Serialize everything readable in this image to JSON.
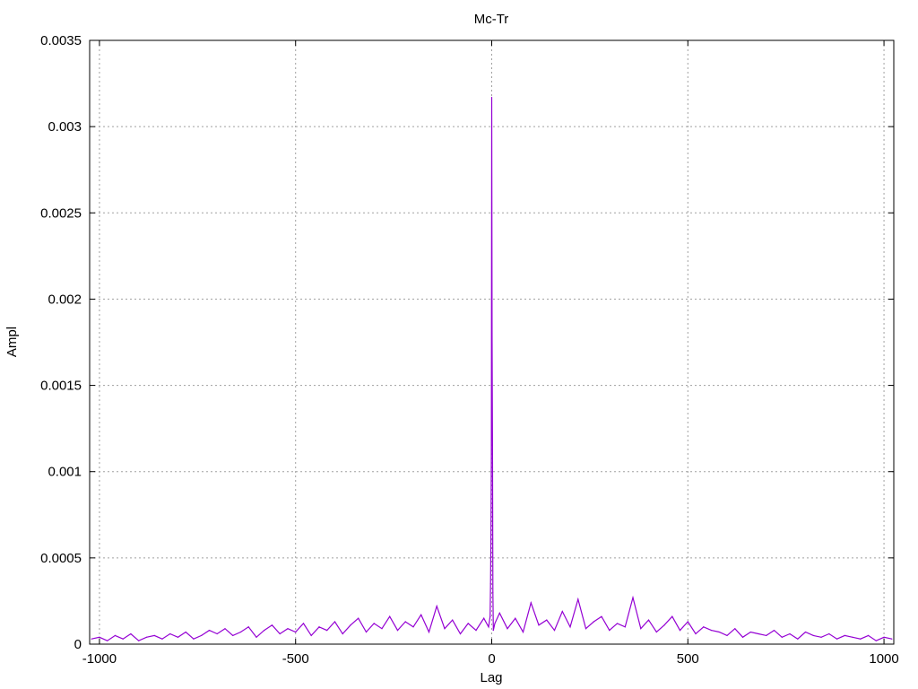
{
  "chart_data": {
    "type": "line",
    "title": "Mc-Tr",
    "xlabel": "Lag",
    "ylabel": "Ampl",
    "xlim": [
      -1025,
      1025
    ],
    "ylim": [
      0,
      0.0035
    ],
    "grid": true,
    "x_ticks": [
      -1000,
      -500,
      0,
      500,
      1000
    ],
    "x_tick_labels": [
      "-1000",
      "-500",
      "0",
      "500",
      "1000"
    ],
    "y_ticks": [
      0,
      0.0005,
      0.001,
      0.0015,
      0.002,
      0.0025,
      0.003,
      0.0035
    ],
    "y_tick_labels": [
      "0",
      "0.0005",
      "0.001",
      "0.0015",
      "0.002",
      "0.0025",
      "0.003",
      "0.0035"
    ],
    "series": [
      {
        "name": "Mc-Tr",
        "color": "#9400d3",
        "x": [
          -1020,
          -1000,
          -980,
          -960,
          -940,
          -920,
          -900,
          -880,
          -860,
          -840,
          -820,
          -800,
          -780,
          -760,
          -740,
          -720,
          -700,
          -680,
          -660,
          -640,
          -620,
          -600,
          -580,
          -560,
          -540,
          -520,
          -500,
          -480,
          -460,
          -440,
          -420,
          -400,
          -380,
          -360,
          -340,
          -320,
          -300,
          -280,
          -260,
          -240,
          -220,
          -200,
          -180,
          -160,
          -140,
          -120,
          -100,
          -80,
          -60,
          -40,
          -20,
          -8,
          -4,
          -3,
          -2,
          -1,
          0,
          1,
          2,
          3,
          4,
          8,
          20,
          40,
          60,
          80,
          100,
          120,
          140,
          160,
          180,
          200,
          220,
          240,
          260,
          280,
          300,
          320,
          340,
          360,
          380,
          400,
          420,
          440,
          460,
          480,
          500,
          520,
          540,
          560,
          580,
          600,
          620,
          640,
          660,
          680,
          700,
          720,
          740,
          760,
          780,
          800,
          820,
          840,
          860,
          880,
          900,
          920,
          940,
          960,
          980,
          1000,
          1020
        ],
        "y": [
          3e-05,
          4e-05,
          2e-05,
          5e-05,
          3e-05,
          6e-05,
          2e-05,
          4e-05,
          5e-05,
          3e-05,
          6e-05,
          4e-05,
          7e-05,
          3e-05,
          5e-05,
          8e-05,
          6e-05,
          9e-05,
          5e-05,
          7e-05,
          0.0001,
          4e-05,
          8e-05,
          0.00011,
          6e-05,
          9e-05,
          7e-05,
          0.00012,
          5e-05,
          0.0001,
          8e-05,
          0.00013,
          6e-05,
          0.00011,
          0.00015,
          7e-05,
          0.00012,
          9e-05,
          0.00016,
          8e-05,
          0.00013,
          0.0001,
          0.00017,
          7e-05,
          0.00022,
          9e-05,
          0.00014,
          6e-05,
          0.00012,
          8e-05,
          0.00015,
          0.0001,
          0.00016,
          0.00035,
          0.0006,
          0.0011,
          0.00317,
          0.0018,
          0.0011,
          0.0003,
          8e-05,
          0.00012,
          0.00018,
          9e-05,
          0.00015,
          7e-05,
          0.00024,
          0.00011,
          0.00014,
          8e-05,
          0.00019,
          0.0001,
          0.00026,
          9e-05,
          0.00013,
          0.00016,
          8e-05,
          0.00012,
          0.0001,
          0.00027,
          9e-05,
          0.00014,
          7e-05,
          0.00011,
          0.00016,
          8e-05,
          0.00013,
          6e-05,
          0.0001,
          8e-05,
          7e-05,
          5e-05,
          9e-05,
          4e-05,
          7e-05,
          6e-05,
          5e-05,
          8e-05,
          4e-05,
          6e-05,
          3e-05,
          7e-05,
          5e-05,
          4e-05,
          6e-05,
          3e-05,
          5e-05,
          4e-05,
          3e-05,
          5e-05,
          2e-05,
          4e-05,
          3e-05
        ]
      }
    ]
  }
}
